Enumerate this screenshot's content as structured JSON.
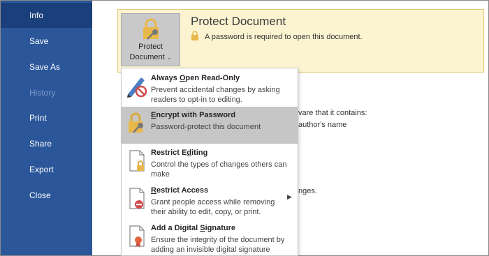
{
  "nav": {
    "info": "Info",
    "save": "Save",
    "save_as": "Save As",
    "history": "History",
    "print": "Print",
    "share": "Share",
    "export": "Export",
    "close": "Close"
  },
  "protect": {
    "button_line1": "Protect",
    "button_line2": "Document",
    "title": "Protect Document",
    "message": "A password is required to open this document."
  },
  "background": {
    "line1": "vare that it contains:",
    "line2": "author's name",
    "line3": "nges."
  },
  "menu": {
    "items": [
      {
        "title_pre": "Always ",
        "title_ul": "O",
        "title_post": "pen Read-Only",
        "desc": "Prevent accidental changes by asking readers to opt-in to editing."
      },
      {
        "title_pre": "",
        "title_ul": "E",
        "title_post": "ncrypt with Password",
        "desc": "Password-protect this document"
      },
      {
        "title_pre": "Restrict E",
        "title_ul": "d",
        "title_post": "iting",
        "desc": "Control the types of changes others can make"
      },
      {
        "title_pre": "",
        "title_ul": "R",
        "title_post": "estrict Access",
        "desc": "Grant people access while removing their ability to edit, copy, or print."
      },
      {
        "title_pre": "Add a Digital ",
        "title_ul": "S",
        "title_post": "ignature",
        "desc": "Ensure the integrity of the document by adding an invisible digital signature"
      }
    ]
  },
  "icons": {
    "lock": "lock-icon",
    "pencil_forbidden": "pencil-no-icon",
    "key_lock": "key-lock-icon",
    "doc_lock": "document-lock-icon",
    "doc_forbidden": "document-no-icon",
    "doc_ribbon": "document-ribbon-icon"
  },
  "colors": {
    "nav_bg": "#2b579a",
    "nav_selected": "#1a3f7a",
    "banner_bg": "#fcf4d1",
    "banner_border": "#e4c677",
    "menu_hover": "#c6c6c6",
    "lock_gold": "#e8b84a"
  }
}
